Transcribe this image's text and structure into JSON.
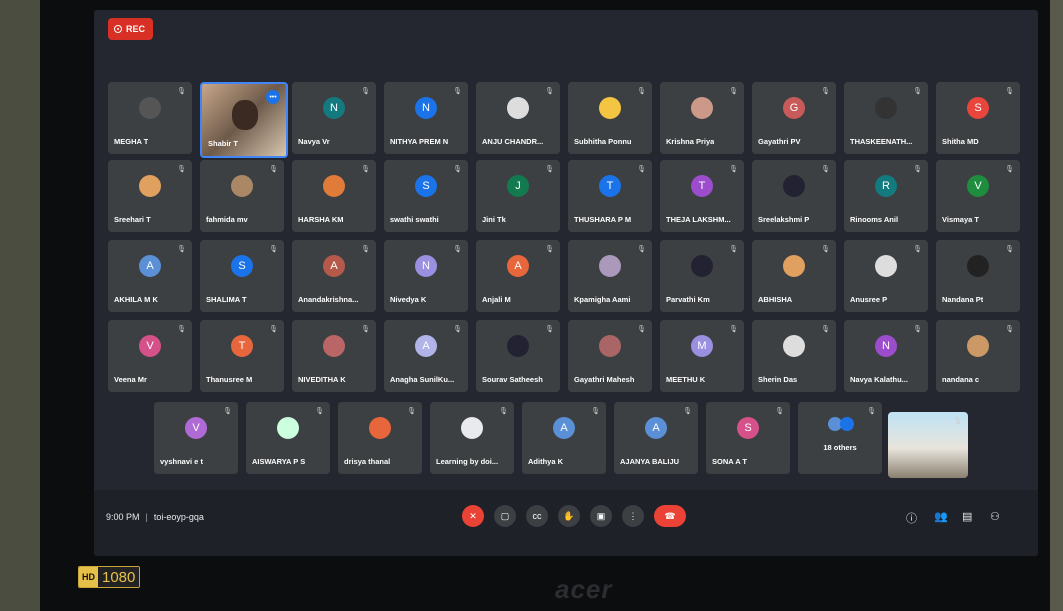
{
  "recording": {
    "label": "REC"
  },
  "rows": [
    [
      {
        "name": "MEGHA T",
        "kind": "photo",
        "color": "#555"
      },
      {
        "name": "Navya Vr",
        "kind": "avatar",
        "initial": "N",
        "color": "#137a7f"
      },
      {
        "name": "NITHYA PREM N",
        "kind": "avatar",
        "initial": "N",
        "color": "#1a73e8"
      },
      {
        "name": "ANJU CHANDR...",
        "kind": "photo",
        "color": "#ddd"
      },
      {
        "name": "Subhitha Ponnu",
        "kind": "photo",
        "color": "#f4c542"
      },
      {
        "name": "Krishna Priya",
        "kind": "photo",
        "color": "#c98"
      },
      {
        "name": "Gayathri PV",
        "kind": "avatar",
        "initial": "G",
        "color": "#c85a5a"
      },
      {
        "name": "THASKEENATH...",
        "kind": "photo",
        "color": "#333"
      },
      {
        "name": "Shitha MD",
        "kind": "avatar",
        "initial": "S",
        "color": "#e8453c"
      }
    ],
    [
      {
        "name": "Sreehari T",
        "kind": "photo",
        "color": "#e0a060"
      },
      {
        "name": "fahmida mv",
        "kind": "photo",
        "color": "#a86"
      },
      {
        "name": "HARSHA KM",
        "kind": "photo",
        "color": "#e07b39"
      },
      {
        "name": "swathi swathi",
        "kind": "avatar",
        "initial": "S",
        "color": "#1a73e8"
      },
      {
        "name": "Jini Tk",
        "kind": "avatar",
        "initial": "J",
        "color": "#137a4f"
      },
      {
        "name": "THUSHARA P M",
        "kind": "avatar",
        "initial": "T",
        "color": "#1a73e8"
      },
      {
        "name": "THEJA LAKSHM...",
        "kind": "avatar",
        "initial": "T",
        "color": "#9c4dcc"
      },
      {
        "name": "Sreelakshmi P",
        "kind": "photo",
        "color": "#223"
      },
      {
        "name": "Rinooms Anil",
        "kind": "avatar",
        "initial": "R",
        "color": "#137a7f"
      },
      {
        "name": "Vismaya T",
        "kind": "avatar",
        "initial": "V",
        "color": "#1e8e3e"
      }
    ],
    [
      {
        "name": "AKHILA M K",
        "kind": "avatar",
        "initial": "A",
        "color": "#5b8fd6"
      },
      {
        "name": "SHALIMA T",
        "kind": "avatar",
        "initial": "S",
        "color": "#1a73e8"
      },
      {
        "name": "Anandakrishna...",
        "kind": "avatar",
        "initial": "A",
        "color": "#b55a4a"
      },
      {
        "name": "Nivedya K",
        "kind": "avatar",
        "initial": "N",
        "color": "#9a8fe0"
      },
      {
        "name": "Anjali M",
        "kind": "avatar",
        "initial": "A",
        "color": "#e8663c"
      },
      {
        "name": "Kpamigha Aami",
        "kind": "photo",
        "color": "#a9b"
      },
      {
        "name": "Parvathi Km",
        "kind": "photo",
        "color": "#223"
      },
      {
        "name": "ABHISHA",
        "kind": "photo",
        "color": "#e0a060"
      },
      {
        "name": "Anusree P",
        "kind": "photo",
        "color": "#ddd"
      },
      {
        "name": "Nandana Pt",
        "kind": "photo",
        "color": "#222"
      }
    ],
    [
      {
        "name": "Veena Mr",
        "kind": "avatar",
        "initial": "V",
        "color": "#d6508a"
      },
      {
        "name": "Thanusree M",
        "kind": "avatar",
        "initial": "T",
        "color": "#e8663c"
      },
      {
        "name": "NIVEDITHA K",
        "kind": "photo",
        "color": "#b66"
      },
      {
        "name": "Anagha SunilKu...",
        "kind": "avatar",
        "initial": "A",
        "color": "#b0b4e8"
      },
      {
        "name": "Sourav Satheesh",
        "kind": "photo",
        "color": "#223"
      },
      {
        "name": "Gayathri Mahesh",
        "kind": "photo",
        "color": "#a66"
      },
      {
        "name": "MEETHU K",
        "kind": "avatar",
        "initial": "M",
        "color": "#9a8fe0"
      },
      {
        "name": "Sherin Das",
        "kind": "photo",
        "color": "#ddd"
      },
      {
        "name": "Navya Kalathu...",
        "kind": "avatar",
        "initial": "N",
        "color": "#9c4dcc"
      },
      {
        "name": "nandana c",
        "kind": "photo",
        "color": "#c96"
      }
    ],
    [
      {
        "name": "vyshnavi e t",
        "kind": "avatar",
        "initial": "V",
        "color": "#b06ad6"
      },
      {
        "name": "AISWARYA P S",
        "kind": "photo",
        "color": "#cfd"
      },
      {
        "name": "drisya thanal",
        "kind": "photo",
        "color": "#e8663c"
      },
      {
        "name": "Learning by doi...",
        "kind": "photo",
        "color": "#e8eaed"
      },
      {
        "name": "Adithya K",
        "kind": "avatar",
        "initial": "A",
        "color": "#5b8fd6"
      },
      {
        "name": "AJANYA BALIJU",
        "kind": "avatar",
        "initial": "A",
        "color": "#5b8fd6"
      },
      {
        "name": "SONA A T",
        "kind": "avatar",
        "initial": "S",
        "color": "#d6508a"
      },
      {
        "name": "18 others",
        "kind": "others",
        "color": "#5b8fd6"
      }
    ]
  ],
  "featured_video": {
    "name": "Shabir T",
    "more": "•••"
  },
  "meeting": {
    "time": "9:00 PM",
    "separator": "|",
    "code": "toi-eoyp-gqa"
  },
  "controls": [
    {
      "name": "mic-toggle-button",
      "glyph": "✕",
      "red": true
    },
    {
      "name": "camera-toggle-button",
      "glyph": "▢",
      "red": false
    },
    {
      "name": "captions-button",
      "glyph": "cc",
      "red": false
    },
    {
      "name": "raise-hand-button",
      "glyph": "✋",
      "red": false
    },
    {
      "name": "present-button",
      "glyph": "▣",
      "red": false
    },
    {
      "name": "more-options-button",
      "glyph": "⋮",
      "red": false
    },
    {
      "name": "leave-call-button",
      "glyph": "☎",
      "red": true,
      "end": true
    }
  ],
  "right_icons": [
    {
      "name": "meeting-details-icon",
      "glyph": "ⓘ"
    },
    {
      "name": "people-icon",
      "glyph": "👥"
    },
    {
      "name": "chat-icon",
      "glyph": "▤"
    },
    {
      "name": "activities-icon",
      "glyph": "⚇"
    }
  ],
  "device": {
    "brand": "acer",
    "sticker_left": "HD",
    "sticker_right": "1080"
  }
}
